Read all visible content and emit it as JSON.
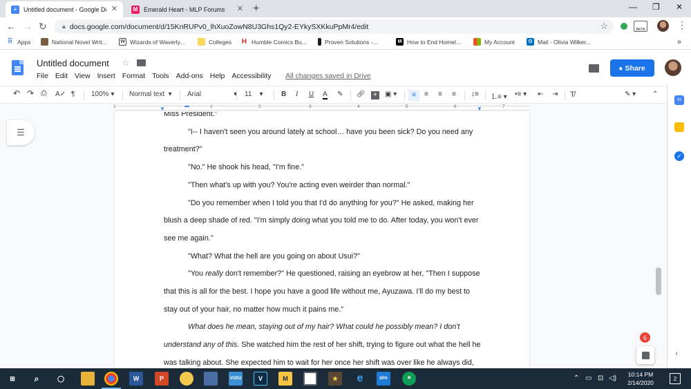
{
  "browser": {
    "tabs": [
      {
        "title": "Untitled document - Google Doc",
        "icon": "google-docs-icon",
        "active": true
      },
      {
        "title": "Emerald Heart - MLP Forums",
        "icon": "mlp-forums-icon",
        "active": false
      }
    ],
    "url": "docs.google.com/document/d/15KnRUPv0_lhXuoZowN8U3Ghs1Qy2-EYkySXKkuPpMr4/edit",
    "extension_badge": "BETA",
    "bookmarks": [
      {
        "label": "Apps",
        "icon": "apps-grid-icon"
      },
      {
        "label": "National Novel Writ...",
        "icon": "nanowrimo-icon"
      },
      {
        "label": "Wizards of Waverly...",
        "icon": "wordpress-icon"
      },
      {
        "label": "Colleges",
        "icon": "folder-icon"
      },
      {
        "label": "Humble Comics Bu...",
        "icon": "humble-icon"
      },
      {
        "label": "Proven Solutions -...",
        "icon": "bookmark-icon"
      },
      {
        "label": "How to End Homel...",
        "icon": "medium-icon"
      },
      {
        "label": "My Account",
        "icon": "microsoft-icon"
      },
      {
        "label": "Mail - Olivia Wilker...",
        "icon": "outlook-icon"
      }
    ]
  },
  "docs": {
    "title": "Untitled document",
    "menu": [
      "File",
      "Edit",
      "View",
      "Insert",
      "Format",
      "Tools",
      "Add-ons",
      "Help",
      "Accessibility"
    ],
    "save_status": "All changes saved in Drive",
    "share_label": "Share",
    "toolbar": {
      "zoom": "100%",
      "style": "Normal text",
      "font": "Arial",
      "font_size": "11"
    },
    "ruler_numbers": [
      "1",
      "1",
      "2",
      "3",
      "4",
      "5",
      "6",
      "7"
    ],
    "notification_count": "6"
  },
  "document": {
    "paragraphs": [
      {
        "runs": [
          {
            "text": "Miss President.\"",
            "italic": false
          }
        ],
        "indent": false
      },
      {
        "runs": [
          {
            "text": "\"I-- I haven't seen you around lately at school… have you been sick? Do you need any treatment?\"",
            "italic": false
          }
        ],
        "indent": true
      },
      {
        "runs": [
          {
            "text": "\"No.\" He shook his head, \"I'm fine.\"",
            "italic": false
          }
        ],
        "indent": true
      },
      {
        "runs": [
          {
            "text": "\"Then what's up with you? You're acting even weirder than normal.\"",
            "italic": false
          }
        ],
        "indent": true
      },
      {
        "runs": [
          {
            "text": "\"Do you remember when I told you that I'd do anything for you?\" He asked, making her blush a deep shade of red. \"I'm simply doing what you told me to do. After today, you won't ever see me again.\"",
            "italic": false
          }
        ],
        "indent": true
      },
      {
        "runs": [
          {
            "text": "\"What? What the hell are you going on about Usui?\"",
            "italic": false
          }
        ],
        "indent": true
      },
      {
        "runs": [
          {
            "text": "\"You ",
            "italic": false
          },
          {
            "text": "really",
            "italic": true
          },
          {
            "text": " don't remember?\" He questioned, raising an eyebrow at her, \"Then I suppose that this is all for the best. I hope you have a good life without me, Ayuzawa. I'll do my best to stay out of your hair, no matter how much it pains me.\"",
            "italic": false
          }
        ],
        "indent": true
      },
      {
        "runs": [
          {
            "text": "What does he mean, staying out of my hair? What could he possibly mean? I don't understand any of this.",
            "italic": true
          },
          {
            "text": " She watched him the rest of her shift, trying to figure out what the hell he was talking about. She expected him to wait for her once her shift was over like he always did,",
            "italic": false
          }
        ],
        "indent": true
      }
    ]
  },
  "taskbar": {
    "apps": [
      {
        "name": "file-explorer"
      },
      {
        "name": "chrome"
      },
      {
        "name": "word",
        "label": "W"
      },
      {
        "name": "powerpoint",
        "label": "P"
      },
      {
        "name": "paint"
      },
      {
        "name": "photos"
      },
      {
        "name": "vudu",
        "label": "VUDU"
      },
      {
        "name": "vegas",
        "label": "V"
      },
      {
        "name": "mango",
        "label": "M"
      },
      {
        "name": "explorer-folder"
      },
      {
        "name": "star-app"
      },
      {
        "name": "edge",
        "label": "e"
      },
      {
        "name": "sketchbook",
        "label": "SPA"
      },
      {
        "name": "hangouts"
      }
    ],
    "time": "10:14 PM",
    "date": "2/14/2020",
    "notification_count": "2"
  },
  "colors": {
    "docs_blue": "#4285f4",
    "share_blue": "#1a73e8",
    "taskbar": "#1c2b3a",
    "badge_red": "#ea4335"
  }
}
